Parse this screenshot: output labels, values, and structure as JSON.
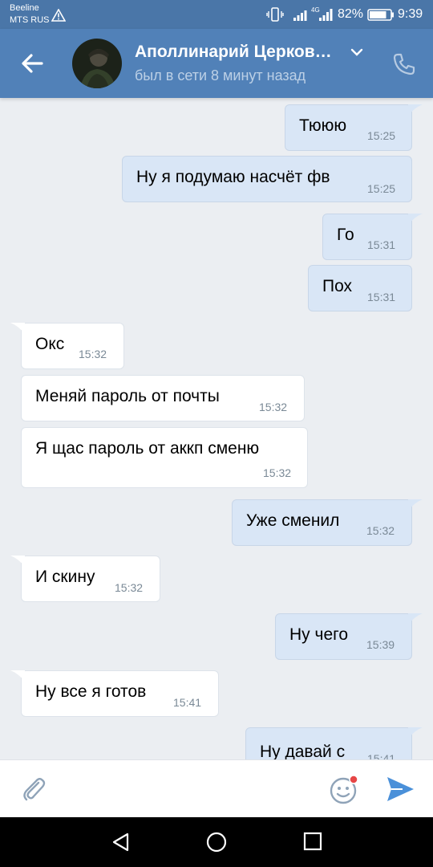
{
  "status_bar": {
    "carrier1": "Beeline",
    "carrier2": "MTS RUS",
    "network": "4G",
    "battery": "82%",
    "time": "9:39"
  },
  "header": {
    "contact_name": "Аполлинарий Церков…",
    "last_seen": "был в сети 8 минут назад"
  },
  "messages": [
    {
      "dir": "out",
      "text": "Тююю",
      "time": "15:25"
    },
    {
      "dir": "out",
      "text": "Ну я подумаю насчёт фв",
      "time": "15:25"
    },
    {
      "dir": "out",
      "text": "Го",
      "time": "15:31"
    },
    {
      "dir": "out",
      "text": "Пох",
      "time": "15:31"
    },
    {
      "dir": "in",
      "text": "Окс",
      "time": "15:32"
    },
    {
      "dir": "in",
      "text": "Меняй пароль от почты",
      "time": "15:32"
    },
    {
      "dir": "in",
      "text": "Я щас пароль от аккп сменю",
      "time": "15:32"
    },
    {
      "dir": "out",
      "text": "Уже сменил",
      "time": "15:32"
    },
    {
      "dir": "in",
      "text": "И скину",
      "time": "15:32"
    },
    {
      "dir": "out",
      "text": "Ну чего",
      "time": "15:39"
    },
    {
      "dir": "in",
      "text": "Ну все я готов",
      "time": "15:41"
    },
    {
      "dir": "out",
      "text": "Ну давай с",
      "time": "15:41"
    }
  ],
  "colors": {
    "header": "#5181b8",
    "status_bar": "#4a76a8",
    "chat_background": "#ebeef2",
    "outgoing_bubble": "#d9e6f6",
    "incoming_bubble": "#ffffff",
    "send_accent": "#4a90d9",
    "notification_dot": "#e64646"
  },
  "icons": {
    "back": "arrow-left-icon",
    "dropdown": "chevron-down-icon",
    "call": "phone-icon",
    "attach": "paperclip-icon",
    "emoji": "smiley-icon",
    "send": "send-arrow-icon"
  }
}
